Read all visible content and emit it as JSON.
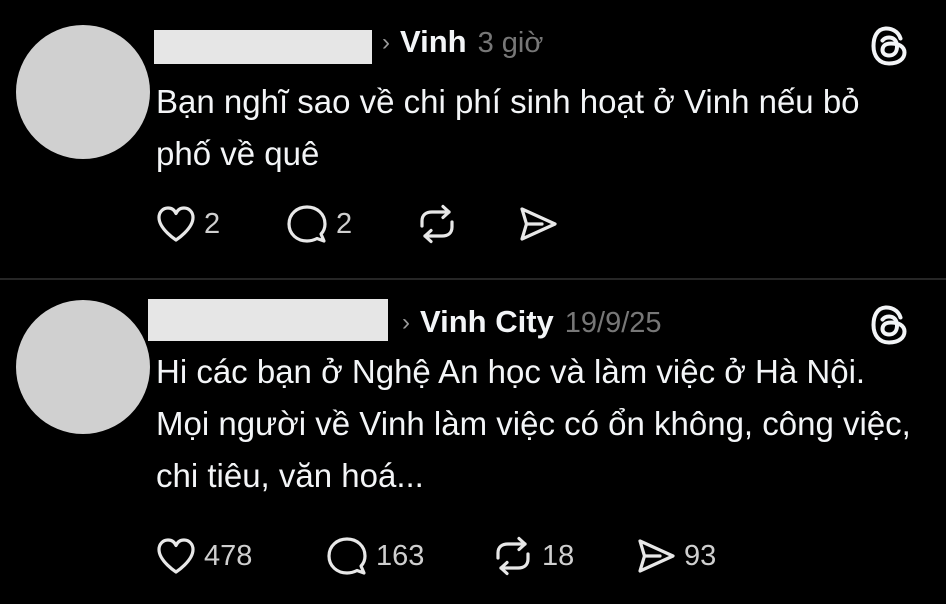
{
  "posts": [
    {
      "community": "Vinh",
      "time": "3 giờ",
      "text": "Bạn nghĩ sao về chi phí sinh hoạt ở Vinh nếu bỏ phố về quê",
      "likes": "2",
      "replies": "2",
      "reposts": "",
      "shares": ""
    },
    {
      "community": "Vinh City",
      "time": "19/9/25",
      "text": "Hi các bạn ở Nghệ An học và làm việc ở Hà Nội. Mọi người về Vinh làm việc có ổn không, công việc, chi tiêu, văn hoá...",
      "likes": "478",
      "replies": "163",
      "reposts": "18",
      "shares": "93"
    }
  ],
  "ui": {
    "chevron": "›",
    "icons": [
      "heart-icon",
      "comment-icon",
      "repost-icon",
      "share-icon",
      "threads-logo-icon",
      "chevron-right-icon"
    ],
    "colors": {
      "background": "#000000",
      "text": "#f3f5f7",
      "muted": "#777777",
      "divider": "#262626",
      "avatar_placeholder": "#d0d0d0"
    }
  }
}
